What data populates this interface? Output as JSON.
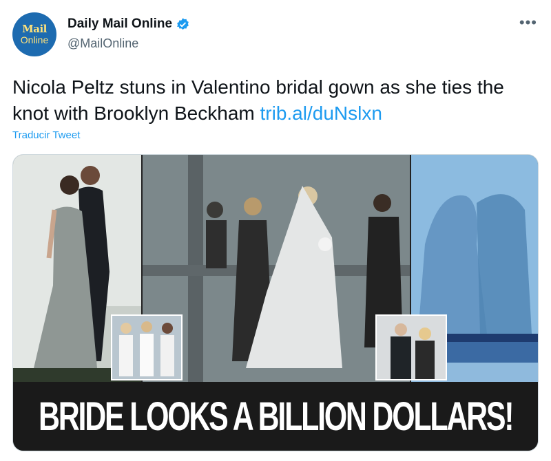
{
  "account": {
    "avatar_line1": "Mail",
    "avatar_line2": "Online",
    "name": "Daily Mail Online",
    "handle": "@MailOnline"
  },
  "menu_icon": "more-horizontal-icon",
  "tweet": {
    "text": "Nicola Peltz stuns in Valentino bridal gown as she ties the knot with Brooklyn Beckham",
    "link": "trib.al/duNslxn",
    "translate_label": "Traducir Tweet"
  },
  "media": {
    "headline": "BRIDE LOOKS A BILLION DOLLARS!"
  },
  "colors": {
    "link": "#1d9bf0",
    "avatar_bg": "#1d6bb0",
    "verified": "#1d9bf0"
  }
}
